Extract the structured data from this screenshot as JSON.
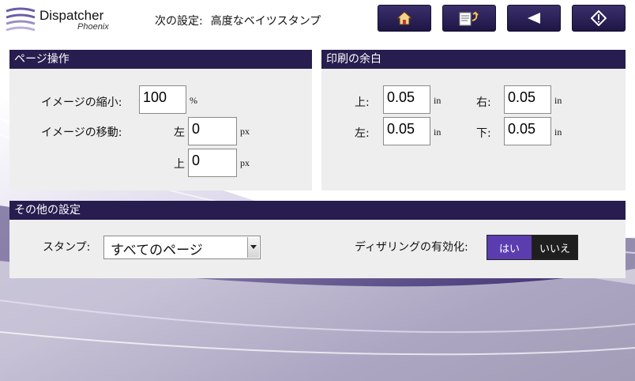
{
  "app": {
    "name": "Dispatcher",
    "subtitle": "Phoenix"
  },
  "nav": {
    "prefix": "次の設定:",
    "current": "高度なベイツスタンプ"
  },
  "toolbar": {
    "home_icon": "home-icon",
    "edit_icon": "edit-undo-icon",
    "back_icon": "back-arrow-icon",
    "start_icon": "start-diamond-icon"
  },
  "page_ops": {
    "title": "ページ操作",
    "scale_label": "イメージの縮小:",
    "scale_value": "100",
    "scale_unit": "%",
    "move_label": "イメージの移動:",
    "left_label": "左",
    "left_value": "0",
    "top_label": "上",
    "top_value": "0",
    "move_unit": "px"
  },
  "margins": {
    "title": "印刷の余白",
    "top_label": "上:",
    "top_value": "0.05",
    "right_label": "右:",
    "right_value": "0.05",
    "left_label": "左:",
    "left_value": "0.05",
    "bottom_label": "下:",
    "bottom_value": "0.05",
    "unit": "in"
  },
  "other": {
    "title": "その他の設定",
    "stamp_label": "スタンプ:",
    "stamp_value": "すべてのページ",
    "dither_label": "ディザリングの有効化:",
    "dither_yes": "はい",
    "dither_no": "いいえ",
    "dither_selected": "はい"
  },
  "colors": {
    "header": "#271d4f",
    "accent": "#5b3db0",
    "panel": "#eeeeee"
  }
}
